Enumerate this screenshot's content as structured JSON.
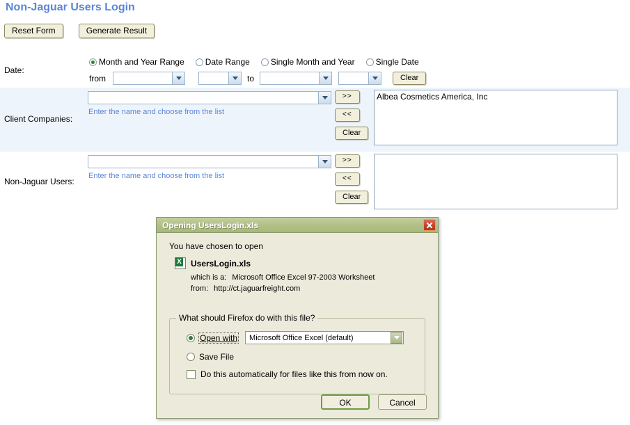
{
  "page": {
    "title": "Non-Jaguar Users Login",
    "title_color": "#5b86d6",
    "toolbar": {
      "reset_label": "Reset Form",
      "generate_label": "Generate Result"
    }
  },
  "date_row": {
    "label": "Date:",
    "options": [
      {
        "label": "Month and Year Range",
        "checked": true
      },
      {
        "label": "Date Range",
        "checked": false
      },
      {
        "label": "Single Month and Year",
        "checked": false
      },
      {
        "label": "Single Date",
        "checked": false
      }
    ],
    "from_label": "from",
    "to_label": "to",
    "from_value": "",
    "date_range_value": "",
    "single_month_value": "",
    "single_date_value": "",
    "clear_label": "Clear"
  },
  "client_companies": {
    "label": "Client Companies:",
    "input_value": "",
    "hint": "Enter the name and choose from the list",
    "add_label": ">>",
    "remove_label": "<<",
    "clear_label": "Clear",
    "selected": [
      "Albea Cosmetics America, Inc"
    ]
  },
  "non_jaguar_users": {
    "label": "Non-Jaguar Users:",
    "input_value": "",
    "hint": "Enter the name and choose from the list",
    "add_label": ">>",
    "remove_label": "<<",
    "clear_label": "Clear",
    "selected": []
  },
  "dialog": {
    "title": "Opening UsersLogin.xls",
    "close_label": "×",
    "chosen_text": "You have chosen to open",
    "file_name": "UsersLogin.xls",
    "which_is_a_label": "which is a:",
    "which_is_a_value": "Microsoft Office Excel 97-2003 Worksheet",
    "from_label": "from:",
    "from_value": "http://ct.jaguarfreight.com",
    "group_legend": "What should Firefox do with this file?",
    "open_with_label": "Open with",
    "open_with_checked": true,
    "app_value": "Microsoft Office Excel (default)",
    "save_file_label": "Save File",
    "save_file_checked": false,
    "auto_label": "Do this automatically for files like this from now on.",
    "auto_checked": false,
    "ok_label": "OK",
    "cancel_label": "Cancel"
  }
}
